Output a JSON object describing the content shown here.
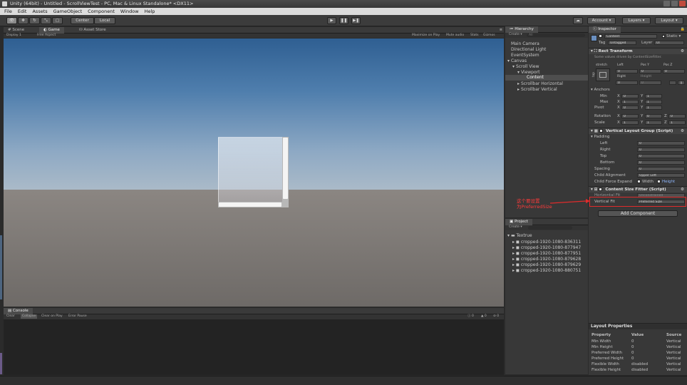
{
  "window": {
    "title": "Unity (64bit) - Untitled - ScrollViewTest - PC, Mac & Linux Standalone* <DX11>"
  },
  "menu": [
    "File",
    "Edit",
    "Assets",
    "GameObject",
    "Component",
    "Window",
    "Help"
  ],
  "toolbar": {
    "pivot_label": "Center",
    "space_label": "Local",
    "account_label": "Account",
    "layers_label": "Layers",
    "layout_label": "Layout"
  },
  "scene_tabs": {
    "scene": "Scene",
    "game": "Game",
    "asset_store": "Asset Store"
  },
  "game_bar": {
    "display": "Display 1",
    "aspect": "Free Aspect",
    "maximize": "Maximize on Play",
    "mute": "Mute audio",
    "stats": "Stats",
    "gizmos": "Gizmos"
  },
  "console": {
    "title": "Console",
    "buttons": [
      "Clear",
      "Collapse",
      "Clear on Play",
      "Error Pause"
    ],
    "counts": [
      "0",
      "0",
      "0"
    ]
  },
  "hierarchy": {
    "title": "Hierarchy",
    "create": "Create",
    "search_placeholder": "All",
    "items": [
      "Main Camera",
      "Directional Light",
      "EventSystem",
      "Canvas",
      "Scroll View",
      "Viewport",
      "Content",
      "Scrollbar Horizontal",
      "Scrollbar Vertical"
    ]
  },
  "project": {
    "title": "Project",
    "create": "Create",
    "folder": "Textrue",
    "files": [
      "cropped-1920-1080-836311",
      "cropped-1920-1080-877947",
      "cropped-1920-1080-877951",
      "cropped-1920-1080-879628",
      "cropped-1920-1080-879629",
      "cropped-1920-1080-880751"
    ]
  },
  "inspector": {
    "title": "Inspector",
    "object_name": "Content",
    "static_label": "Static",
    "tag_label": "Tag",
    "tag_value": "Untagged",
    "layer_label": "Layer",
    "layer_value": "UI",
    "rect_transform": {
      "title": "Rect Transform",
      "note": "Some values driven by ContentSizeFitter.",
      "anchor_preset": "stretch",
      "side_label": "top",
      "left_label": "Left",
      "posy_label": "Pos Y",
      "posz_label": "Pos Z",
      "left": "0",
      "posy": "0",
      "posz": "0",
      "right_label": "Right",
      "height_label": "Height",
      "right": "0",
      "height": "0",
      "anchors_label": "Anchors",
      "min_label": "Min",
      "max_label": "Max",
      "pivot_label": "Pivot",
      "x_label": "X",
      "y_label": "Y",
      "z_label": "Z",
      "min_x": "0",
      "min_y": "1",
      "max_x": "1",
      "max_y": "1",
      "pivot_x": "0",
      "pivot_y": "1",
      "rotation_label": "Rotation",
      "scale_label": "Scale",
      "rot_x": "0",
      "rot_y": "0",
      "rot_z": "0",
      "scale_x": "1",
      "scale_y": "1",
      "scale_z": "1"
    },
    "vertical_layout": {
      "title": "Vertical Layout Group (Script)",
      "padding_label": "Padding",
      "left_label": "Left",
      "right_label": "Right",
      "top_label": "Top",
      "bottom_label": "Bottom",
      "left": "0",
      "right": "0",
      "top": "0",
      "bottom": "0",
      "spacing_label": "Spacing",
      "spacing": "0",
      "alignment_label": "Child Alignment",
      "alignment": "Upper Left",
      "expand_label": "Child Force Expand",
      "width_label": "Width",
      "height_label": "Height"
    },
    "content_size_fitter": {
      "title": "Content Size Fitter (Script)",
      "horizontal_label": "Horizontal Fit",
      "horizontal": "Unconstrained",
      "vertical_label": "Vertical Fit",
      "vertical": "Preferred Size"
    },
    "add_component": "Add Component",
    "layout_properties": {
      "title": "Layout Properties",
      "headers": [
        "Property",
        "Value",
        "Source"
      ],
      "rows": [
        [
          "Min Width",
          "0",
          "Vertical"
        ],
        [
          "Min Height",
          "0",
          "Vertical"
        ],
        [
          "Preferred Width",
          "0",
          "Vertical"
        ],
        [
          "Preferred Height",
          "0",
          "Vertical"
        ],
        [
          "Flexible Width",
          "disabled",
          "Vertical"
        ],
        [
          "Flexible Height",
          "disabled",
          "Vertical"
        ]
      ]
    }
  },
  "annotation": {
    "line1": "这个要设置",
    "line2": "为PreferredSize"
  },
  "colors": {
    "annotation": "#e02b2b",
    "sky_top": "#2f5f92",
    "ground": "#8b8682"
  }
}
